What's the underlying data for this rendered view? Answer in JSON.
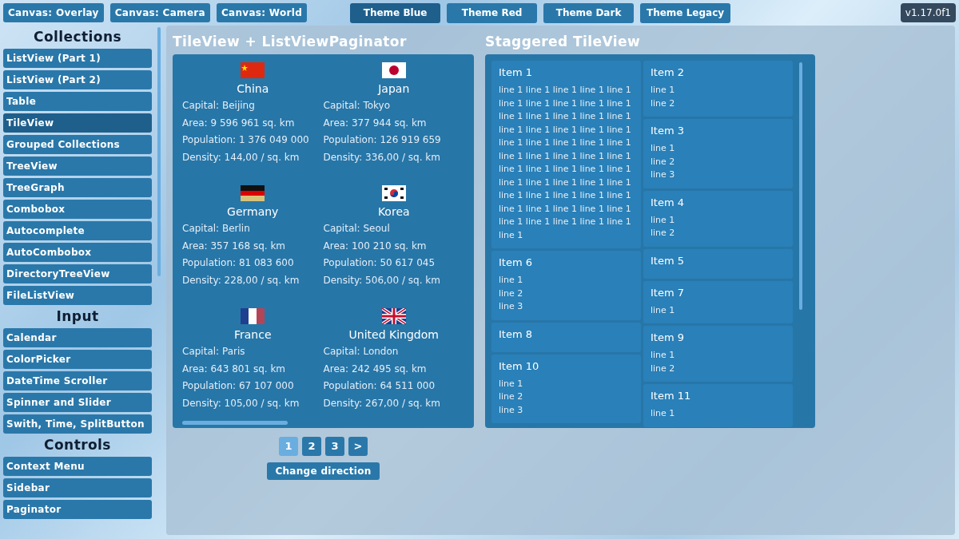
{
  "top_bar": {
    "canvas_buttons": [
      "Canvas: Overlay",
      "Canvas: Camera",
      "Canvas: World"
    ],
    "theme_tabs": [
      {
        "label": "Theme Blue",
        "selected": true
      },
      {
        "label": "Theme Red",
        "selected": false
      },
      {
        "label": "Theme Dark",
        "selected": false
      },
      {
        "label": "Theme Legacy",
        "selected": false
      }
    ],
    "version": "v1.17.0f1"
  },
  "sidebar": {
    "sections": [
      {
        "title": "Collections",
        "items": [
          {
            "label": "ListView (Part 1)",
            "selected": false
          },
          {
            "label": "ListView (Part 2)",
            "selected": false
          },
          {
            "label": "Table",
            "selected": false
          },
          {
            "label": "TileView",
            "selected": true
          },
          {
            "label": "Grouped Collections",
            "selected": false
          },
          {
            "label": "TreeView",
            "selected": false
          },
          {
            "label": "TreeGraph",
            "selected": false
          },
          {
            "label": "Combobox",
            "selected": false
          },
          {
            "label": "Autocomplete",
            "selected": false
          },
          {
            "label": "AutoCombobox",
            "selected": false
          },
          {
            "label": "DirectoryTreeView",
            "selected": false
          },
          {
            "label": "FileListView",
            "selected": false
          }
        ]
      },
      {
        "title": "Input",
        "items": [
          {
            "label": "Calendar",
            "selected": false
          },
          {
            "label": "ColorPicker",
            "selected": false
          },
          {
            "label": "DateTime Scroller",
            "selected": false
          },
          {
            "label": "Spinner and Slider",
            "selected": false
          },
          {
            "label": "Swith, Time, SplitButton",
            "selected": false
          }
        ]
      },
      {
        "title": "Controls",
        "items": [
          {
            "label": "Context Menu",
            "selected": false
          },
          {
            "label": "Sidebar",
            "selected": false
          },
          {
            "label": "Paginator",
            "selected": false
          }
        ]
      }
    ]
  },
  "tile_view": {
    "title": "TileView + ListViewPaginator",
    "tiles": [
      {
        "kind": "cn",
        "name": "China",
        "lines": [
          "Capital: Beijing",
          "Area: 9 596 961 sq. km",
          "Population: 1 376 049 000",
          "Density: 144,00 / sq. km"
        ]
      },
      {
        "kind": "jp",
        "name": "Japan",
        "lines": [
          "Capital: Tokyo",
          "Area: 377 944 sq. km",
          "Population: 126 919 659",
          "Density: 336,00 / sq. km"
        ]
      },
      {
        "kind": "de",
        "name": "Germany",
        "lines": [
          "Capital: Berlin",
          "Area: 357 168 sq. km",
          "Population: 81 083 600",
          "Density: 228,00 / sq. km"
        ]
      },
      {
        "kind": "kr",
        "name": "Korea",
        "lines": [
          "Capital: Seoul",
          "Area: 100 210 sq. km",
          "Population: 50 617 045",
          "Density: 506,00 / sq. km"
        ]
      },
      {
        "kind": "fr",
        "name": "France",
        "lines": [
          "Capital: Paris",
          "Area: 643 801 sq. km",
          "Population: 67 107 000",
          "Density: 105,00 / sq. km"
        ]
      },
      {
        "kind": "gb",
        "name": "United Kingdom",
        "lines": [
          "Capital: London",
          "Area: 242 495 sq. km",
          "Population: 64 511 000",
          "Density: 267,00 / sq. km"
        ]
      }
    ],
    "pages": [
      {
        "label": "1",
        "selected": true
      },
      {
        "label": "2",
        "selected": false
      },
      {
        "label": "3",
        "selected": false
      },
      {
        "label": ">",
        "selected": false
      }
    ],
    "direction_button": "Change direction"
  },
  "staggered_view": {
    "title": "Staggered TileView",
    "columns": [
      [
        {
          "title": "Item 1",
          "lines": [
            "line 1 line 1 line 1 line 1 line 1",
            "line 1 line 1 line 1 line 1 line 1",
            "line 1 line 1 line 1 line 1 line 1",
            "line 1 line 1 line 1 line 1 line 1",
            "line 1 line 1 line 1 line 1 line 1",
            "line 1 line 1 line 1 line 1 line 1",
            "line 1 line 1 line 1 line 1 line 1",
            "line 1 line 1 line 1 line 1 line 1",
            "line 1 line 1 line 1 line 1 line 1",
            "line 1 line 1 line 1 line 1 line 1",
            "line 1 line 1 line 1 line 1 line 1",
            "line 1"
          ]
        },
        {
          "title": "Item 6",
          "lines": [
            "line 1",
            "line 2",
            "line 3"
          ]
        },
        {
          "title": "Item 8"
        },
        {
          "title": "Item 10",
          "lines": [
            "line 1",
            "line 2",
            "line 3"
          ]
        }
      ],
      [
        {
          "title": "Item 2",
          "lines": [
            "line 1",
            "line 2"
          ]
        },
        {
          "title": "Item 3",
          "lines": [
            "line 1",
            "line 2",
            "line 3"
          ]
        },
        {
          "title": "Item 4",
          "lines": [
            "line 1",
            "line 2"
          ]
        },
        {
          "title": "Item 5"
        },
        {
          "title": "Item 7",
          "lines": [
            "line 1"
          ]
        },
        {
          "title": "Item 9",
          "lines": [
            "line 1",
            "line 2"
          ]
        },
        {
          "title": "Item 11",
          "lines": [
            "line 1"
          ]
        }
      ]
    ]
  }
}
